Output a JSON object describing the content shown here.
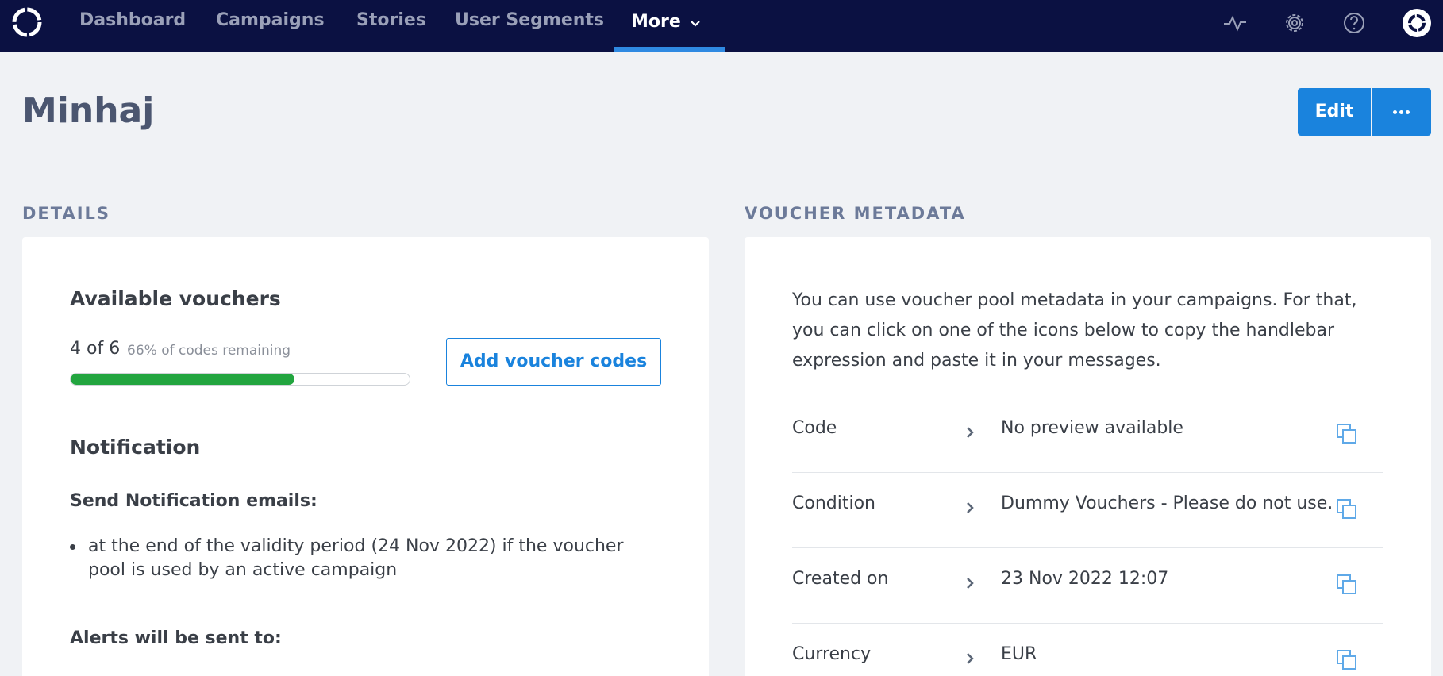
{
  "nav": {
    "items": [
      {
        "label": "Dashboard"
      },
      {
        "label": "Campaigns"
      },
      {
        "label": "Stories"
      },
      {
        "label": "User Segments"
      },
      {
        "label": "More"
      }
    ]
  },
  "header": {
    "title": "Minhaj",
    "edit_label": "Edit"
  },
  "details": {
    "section_title": "DETAILS",
    "available_title": "Available vouchers",
    "count_text": "4 of 6",
    "remaining_text": "66% of codes remaining",
    "remaining_fraction": 0.66,
    "add_button_label": "Add voucher codes",
    "notification_title": "Notification",
    "send_label": "Send Notification emails:",
    "bullets": [
      "at the end of the validity period (24 Nov 2022) if the voucher pool is used by an active campaign"
    ],
    "alerts_label": "Alerts will be sent to:"
  },
  "metadata": {
    "section_title": "VOUCHER METADATA",
    "description": "You can use voucher pool metadata in your campaigns. For that, you can click on one of the icons below to copy the handlebar expression and paste it in your messages.",
    "rows": [
      {
        "key": "Code",
        "value": "No preview available"
      },
      {
        "key": "Condition",
        "value": "Dummy Vouchers - Please do not use."
      },
      {
        "key": "Created on",
        "value": "23 Nov 2022 12:07"
      },
      {
        "key": "Currency",
        "value": "EUR"
      }
    ]
  },
  "colors": {
    "nav_bg": "#0b1142",
    "accent": "#1a83dd",
    "progress": "#22a53f"
  },
  "icons": [
    "logo-icon",
    "chevron-down-icon",
    "activity-icon",
    "gear-icon",
    "help-icon",
    "profile-icon",
    "chevron-right-icon",
    "copy-icon"
  ]
}
